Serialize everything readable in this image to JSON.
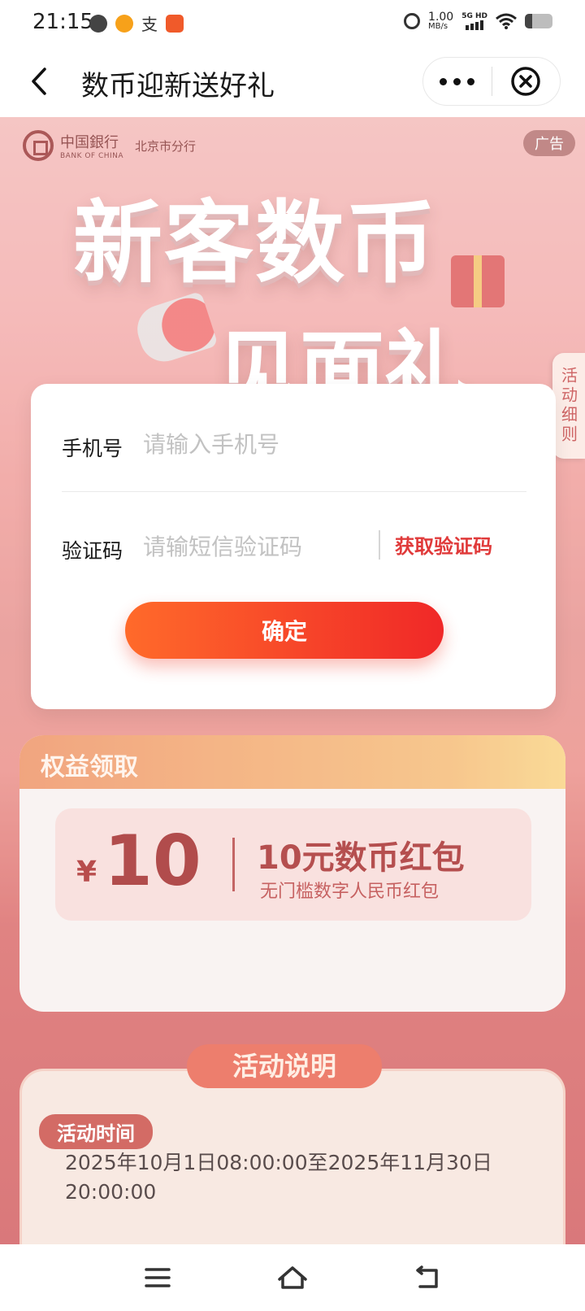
{
  "status_bar": {
    "time": "21:15",
    "speed": "1.00",
    "speed_unit": "MB/s",
    "network": "5G HD",
    "battery_level": 0.25
  },
  "nav": {
    "title": "数币迎新送好礼"
  },
  "banner": {
    "bank_name_cn": "中国銀行",
    "bank_name_en": "BANK OF CHINA",
    "branch": "北京市分行",
    "ad_tag": "广告",
    "hero_line1": "新客数币",
    "hero_line2": "见面礼",
    "rules_tab": "活动细则"
  },
  "benefits": {
    "title": "权益领取",
    "coupon": {
      "currency": "¥",
      "amount": "10",
      "name": "10元数币红包",
      "desc": "无门槛数字人民币红包"
    }
  },
  "description": {
    "header": "活动说明",
    "time_tag": "活动时间",
    "time_text": "2025年10月1日08:00:00至2025年11月30日20:00:00"
  },
  "modal": {
    "phone_label": "手机号",
    "phone_placeholder": "请输入手机号",
    "code_label": "验证码",
    "code_placeholder": "请输短信验证码",
    "get_code": "获取验证码",
    "confirm": "确定"
  },
  "colors": {
    "accent": "#e03a3a",
    "button_start": "#ff6a2a",
    "button_end": "#f02828"
  }
}
